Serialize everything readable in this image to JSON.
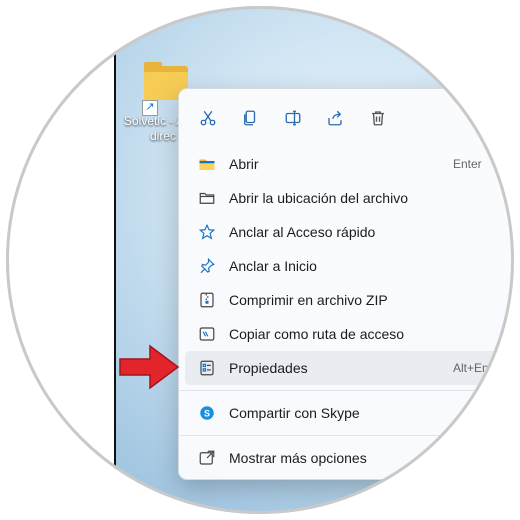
{
  "desktop": {
    "icon_label_line1": "Solvetic - A",
    "icon_label_line2": "direc"
  },
  "context_menu": {
    "toolbar": [
      {
        "name": "cut-icon",
        "title": "Cortar"
      },
      {
        "name": "copy-icon",
        "title": "Copiar"
      },
      {
        "name": "rename-icon",
        "title": "Cambiar nombre"
      },
      {
        "name": "share-icon",
        "title": "Compartir"
      },
      {
        "name": "delete-icon",
        "title": "Eliminar"
      }
    ],
    "items": [
      {
        "label": "Abrir",
        "shortcut": "Enter",
        "icon": "folder-open-icon"
      },
      {
        "label": "Abrir la ubicación del archivo",
        "shortcut": "",
        "icon": "folder-outline-icon"
      },
      {
        "label": "Anclar al Acceso rápido",
        "shortcut": "",
        "icon": "star-icon"
      },
      {
        "label": "Anclar a Inicio",
        "shortcut": "",
        "icon": "pin-icon"
      },
      {
        "label": "Comprimir en archivo ZIP",
        "shortcut": "",
        "icon": "zip-icon"
      },
      {
        "label": "Copiar como ruta de acceso",
        "shortcut": "",
        "icon": "path-icon"
      },
      {
        "label": "Propiedades",
        "shortcut": "Alt+Ent",
        "icon": "properties-icon"
      },
      {
        "label": "Compartir con Skype",
        "shortcut": "",
        "icon": "skype-icon"
      },
      {
        "label": "Mostrar más opciones",
        "shortcut": "",
        "icon": "more-options-icon"
      }
    ]
  },
  "colors": {
    "accent": "#1a73c8",
    "arrow": "#e3242b",
    "folder": "#f7cc55"
  }
}
